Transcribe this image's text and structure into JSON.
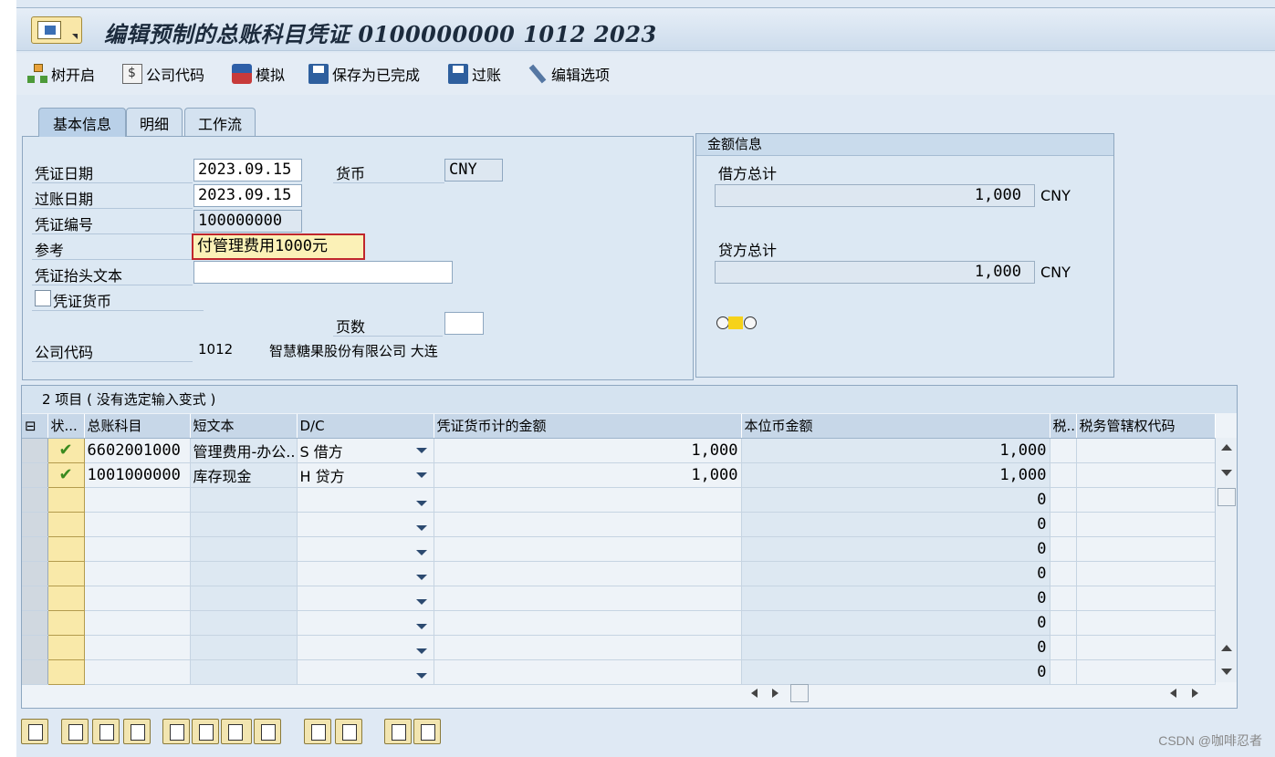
{
  "window": {
    "title": "编辑预制的总账科目凭证 0100000000 1012 2023"
  },
  "toolbar": [
    {
      "label": "树开启",
      "icon": "tree-icon"
    },
    {
      "label": "公司代码",
      "icon": "company-code-icon"
    },
    {
      "label": "模拟",
      "icon": "simulate-icon"
    },
    {
      "label": "保存为已完成",
      "icon": "save-icon"
    },
    {
      "label": "过账",
      "icon": "post-icon"
    },
    {
      "label": "编辑选项",
      "icon": "edit-options-icon"
    }
  ],
  "tabs": [
    "基本信息",
    "明细",
    "工作流"
  ],
  "header": {
    "doc_date_label": "凭证日期",
    "doc_date": "2023.09.15",
    "currency_label": "货币",
    "currency": "CNY",
    "post_date_label": "过账日期",
    "post_date": "2023.09.15",
    "doc_no_label": "凭证编号",
    "doc_no": "100000000",
    "ref_label": "参考",
    "ref": "付管理费用1000元",
    "header_text_label": "凭证抬头文本",
    "header_text": "",
    "doc_currency_label": "凭证货币",
    "pages_label": "页数",
    "pages": "",
    "company_label": "公司代码",
    "company_code": "1012",
    "company_name": "智慧糖果股份有限公司 大连"
  },
  "amount_info": {
    "title": "金额信息",
    "debit_label": "借方总计",
    "debit": "1,000",
    "debit_cur": "CNY",
    "credit_label": "贷方总计",
    "credit": "1,000",
    "credit_cur": "CNY"
  },
  "items": {
    "title": "2 项目 ( 没有选定输入变式 )",
    "columns": [
      "状...",
      "总账科目",
      "短文本",
      "D/C",
      "凭证货币计的金额",
      "本位币金额",
      "税..",
      "税务管辖权代码"
    ],
    "rows": [
      {
        "account": "6602001000",
        "text": "管理费用-办公...",
        "dc": "S 借方",
        "doc_amt": "1,000",
        "local_amt": "1,000",
        "ok": true
      },
      {
        "account": "1001000000",
        "text": "库存现金",
        "dc": "H 贷方",
        "doc_amt": "1,000",
        "local_amt": "1,000",
        "ok": true
      },
      {
        "account": "",
        "text": "",
        "dc": "",
        "doc_amt": "",
        "local_amt": "0",
        "ok": false
      },
      {
        "account": "",
        "text": "",
        "dc": "",
        "doc_amt": "",
        "local_amt": "0",
        "ok": false
      },
      {
        "account": "",
        "text": "",
        "dc": "",
        "doc_amt": "",
        "local_amt": "0",
        "ok": false
      },
      {
        "account": "",
        "text": "",
        "dc": "",
        "doc_amt": "",
        "local_amt": "0",
        "ok": false
      },
      {
        "account": "",
        "text": "",
        "dc": "",
        "doc_amt": "",
        "local_amt": "0",
        "ok": false
      },
      {
        "account": "",
        "text": "",
        "dc": "",
        "doc_amt": "",
        "local_amt": "0",
        "ok": false
      },
      {
        "account": "",
        "text": "",
        "dc": "",
        "doc_amt": "",
        "local_amt": "0",
        "ok": false
      },
      {
        "account": "",
        "text": "",
        "dc": "",
        "doc_amt": "",
        "local_amt": "0",
        "ok": false
      }
    ]
  },
  "watermark": "CSDN @咖啡忍者",
  "colors": {
    "accent": "#2e5f9e",
    "panel": "#dce8f3",
    "highlight": "#fbf1b7",
    "check": "#3a8a1f"
  }
}
